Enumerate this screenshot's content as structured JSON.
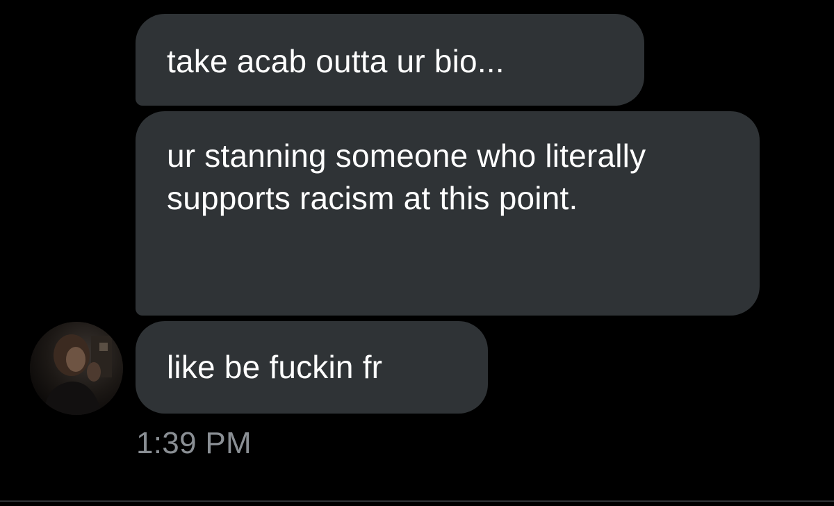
{
  "messages": [
    {
      "text": "take acab outta ur bio..."
    },
    {
      "text": "ur stanning someone who literally supports racism at this point."
    },
    {
      "text": "like be fuckin fr"
    }
  ],
  "timestamp": "1:39 PM",
  "avatar": {
    "icon": "user-avatar-photo"
  },
  "colors": {
    "background": "#000000",
    "bubble": "#2f3336",
    "message_text": "#ffffff",
    "timestamp_text": "#8a8f94"
  }
}
